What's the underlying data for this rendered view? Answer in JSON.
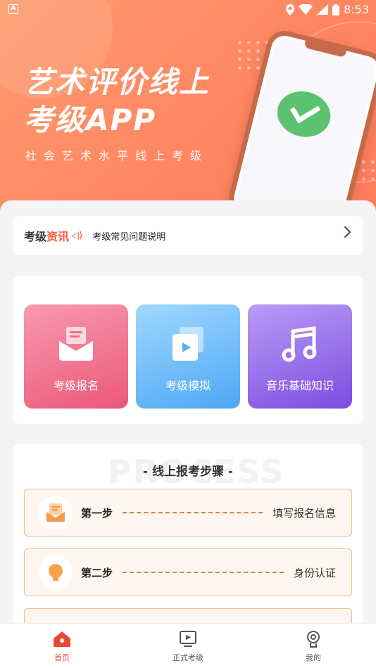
{
  "status_bar": {
    "time": "8:53"
  },
  "hero": {
    "title_line1": "艺术评价线上",
    "title_line2": "考级APP",
    "subtitle": "社会艺术水平线上考级"
  },
  "news": {
    "tag_part1": "考级",
    "tag_part2": "资讯",
    "text": "考级常见问题说明"
  },
  "cards": [
    {
      "label": "考级报名",
      "icon": "mail-icon"
    },
    {
      "label": "考级模拟",
      "icon": "video-play-icon"
    },
    {
      "label": "音乐基础知识",
      "icon": "music-note-icon"
    }
  ],
  "steps": {
    "bg_word": "PROCESS",
    "title": "- 线上报考步骤 -",
    "items": [
      {
        "name": "第一步",
        "desc": "填写报名信息",
        "icon": "form-icon"
      },
      {
        "name": "第二步",
        "desc": "身份认证",
        "icon": "id-bulb-icon"
      }
    ]
  },
  "bottom_nav": [
    {
      "label": "首页",
      "icon": "home-icon",
      "active": true
    },
    {
      "label": "正式考级",
      "icon": "exam-play-icon",
      "active": false
    },
    {
      "label": "我的",
      "icon": "profile-bulb-icon",
      "active": false
    }
  ],
  "colors": {
    "accent": "#e5493a",
    "hero": "#ff8a63"
  }
}
